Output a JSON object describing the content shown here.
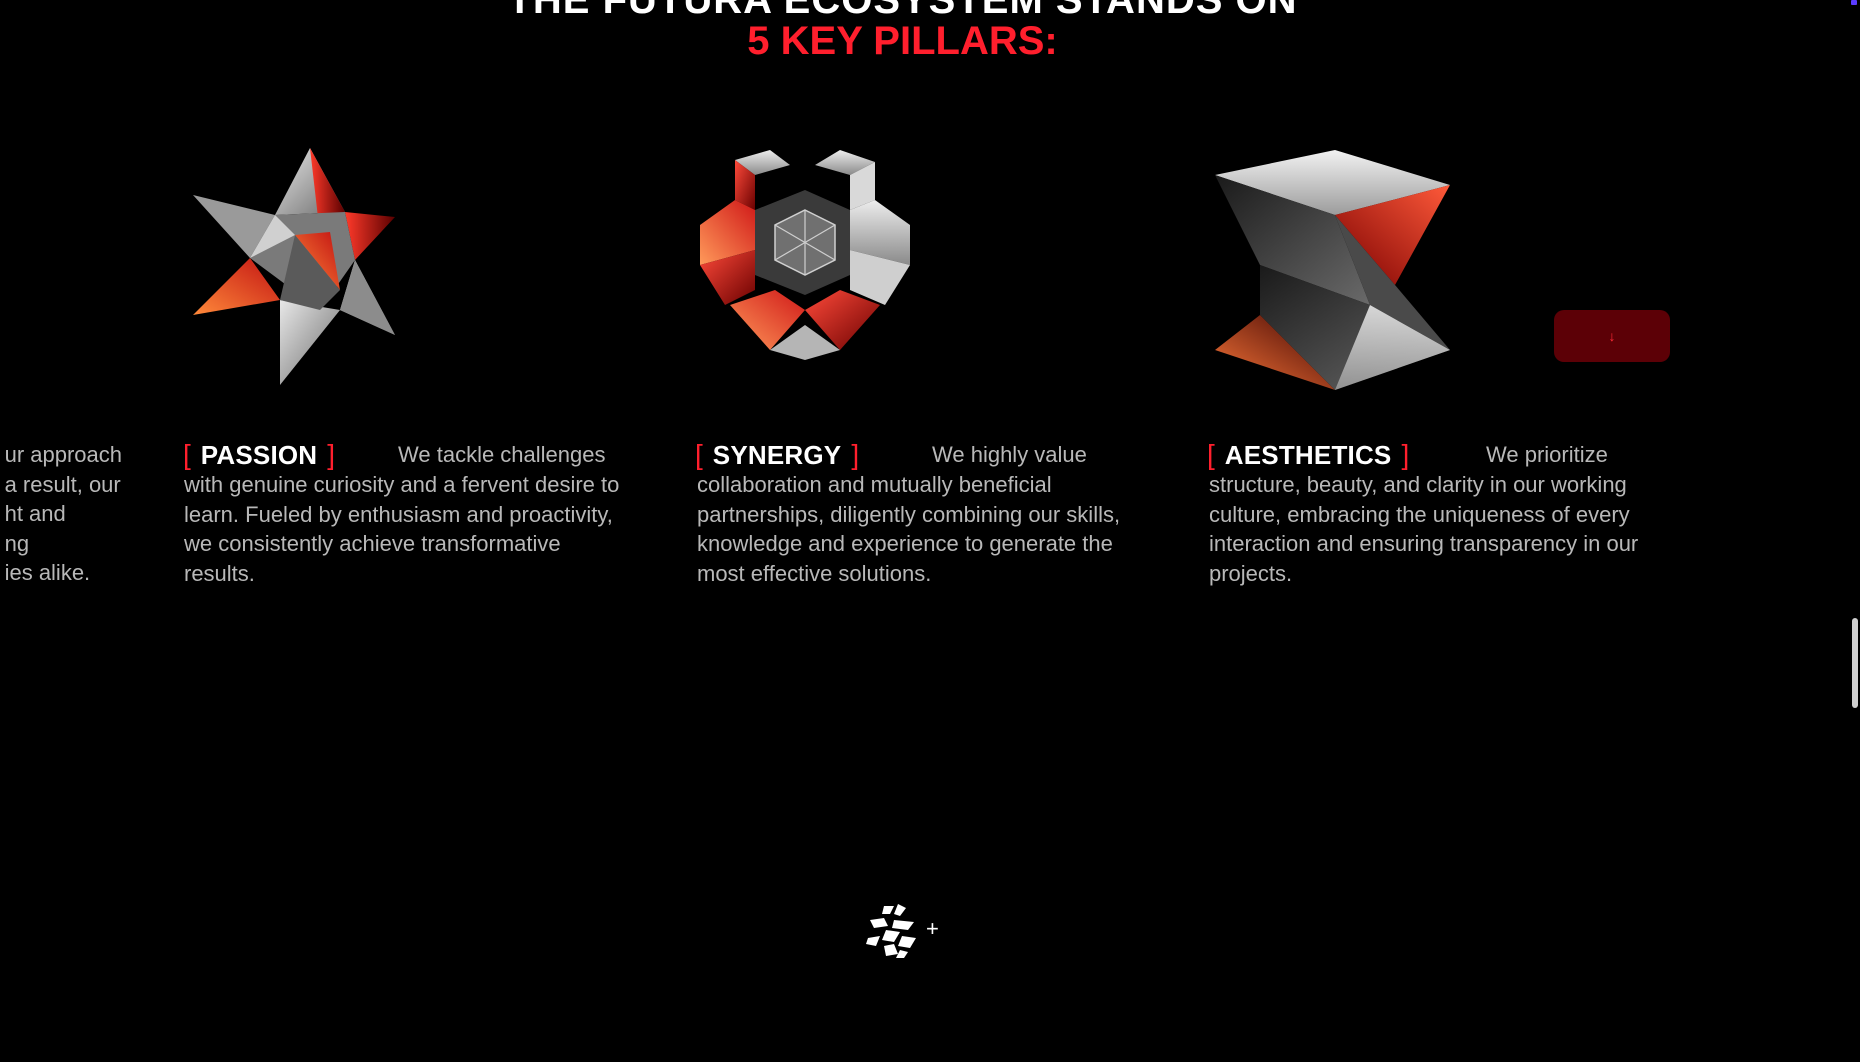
{
  "heading": {
    "line1": "THE FUTURA ECOSYSTEM STANDS ON",
    "line2": "5 KEY PILLARS:"
  },
  "colors": {
    "background": "#000000",
    "accent": "#ff1f2d",
    "body_text": "#b8b8b8",
    "button_bg": "#5c0006"
  },
  "previous_pillar_fragment": {
    "lines": "ur approach\na result, our\nht and\nng\nies alike."
  },
  "pillars": [
    {
      "bracket_open": "[",
      "name": "PASSION",
      "bracket_close": "]",
      "lead": "We tackle challenges",
      "body": "with genuine curiosity and a fervent desire to\nlearn. Fueled by enthusiasm and proactivity,\nwe consistently achieve transformative\nresults.",
      "icon": "star-octahedron-icon"
    },
    {
      "bracket_open": "[",
      "name": "SYNERGY",
      "bracket_close": "]",
      "lead": "We highly value",
      "body": "collaboration and mutually beneficial\npartnerships, diligently combining our skills,\nknowledge and experience to generate the\nmost effective solutions.",
      "icon": "interlocking-cube-icon"
    },
    {
      "bracket_open": "[",
      "name": "AESTHETICS",
      "bracket_close": "]",
      "lead": "We prioritize",
      "body": "structure, beauty, and clarity in our working\nculture, embracing the uniqueness of every\ninteraction and ensuring transparency in our\nprojects.",
      "icon": "twisted-prism-icon"
    }
  ],
  "scroll_button": {
    "label": "↓",
    "icon": "arrow-down-icon"
  },
  "footer": {
    "logo_icon": "futura-logo-icon",
    "plus": "+"
  }
}
